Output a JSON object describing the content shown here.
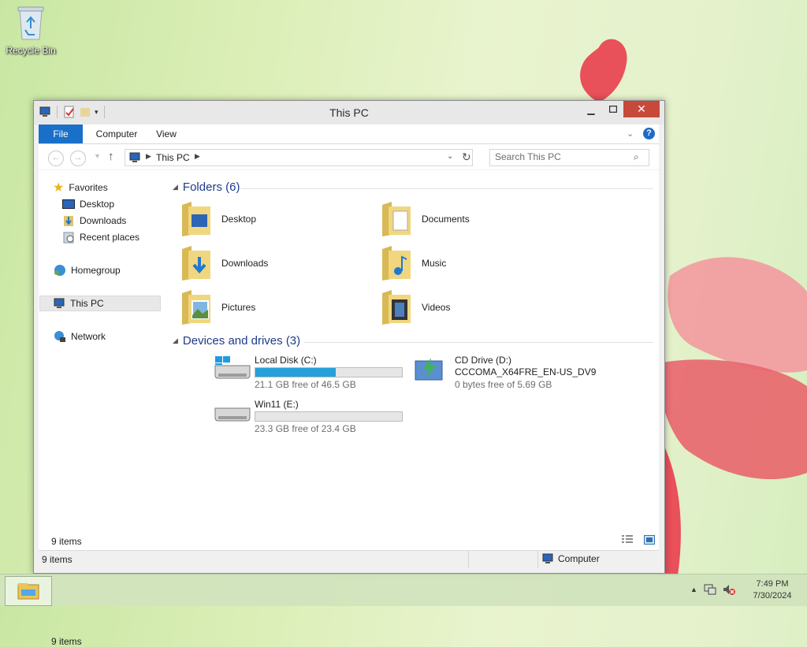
{
  "desktop": {
    "recycle_bin_label": "Recycle Bin"
  },
  "window": {
    "title": "This PC",
    "min_icon": "minimize-icon",
    "max_icon": "maximize-icon",
    "close_symbol": "✕"
  },
  "ribbon": {
    "tabs": [
      {
        "label": "File"
      },
      {
        "label": "Computer"
      },
      {
        "label": "View"
      }
    ],
    "help_symbol": "?"
  },
  "address": {
    "crumb": "This PC",
    "search_placeholder": "Search This PC"
  },
  "navigation": {
    "favorites": "Favorites",
    "desktop": "Desktop",
    "downloads": "Downloads",
    "recent_places": "Recent places",
    "homegroup": "Homegroup",
    "this_pc": "This PC",
    "network": "Network"
  },
  "folders_group": {
    "title": "Folders (6)",
    "items": [
      {
        "label": "Desktop"
      },
      {
        "label": "Documents"
      },
      {
        "label": "Downloads"
      },
      {
        "label": "Music"
      },
      {
        "label": "Pictures"
      },
      {
        "label": "Videos"
      }
    ]
  },
  "devices_group": {
    "title": "Devices and drives (3)",
    "drives": [
      {
        "name": "Local Disk (C:)",
        "free": "21.1 GB free of 46.5 GB",
        "used_fraction": 0.55
      },
      {
        "name": "Win11 (E:)",
        "free": "23.3 GB free of 23.4 GB",
        "used_fraction": 0.0
      },
      {
        "name": "CD Drive (D:)",
        "volume": "CCCOMA_X64FRE_EN-US_DV9",
        "free": "0 bytes free of 5.69 GB"
      }
    ]
  },
  "status": {
    "item_count_inner": "9 items",
    "item_count": "9 items",
    "location": "Computer"
  },
  "taskbar": {
    "time": "7:49 PM",
    "date": "7/30/2024"
  },
  "colors": {
    "accent": "#1a6fc8",
    "progress": "#26a0da",
    "close": "#c7493a"
  }
}
